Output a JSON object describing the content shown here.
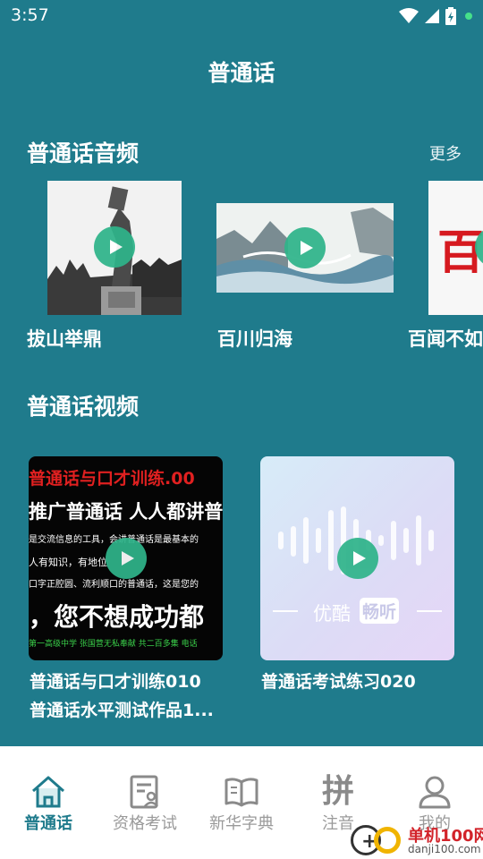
{
  "status_bar": {
    "time": "3:57"
  },
  "header": {
    "title": "普通话"
  },
  "audio_section": {
    "title": "普通话音频",
    "more": "更多",
    "items": [
      {
        "label": "拔山举鼎"
      },
      {
        "label": "百川归海"
      },
      {
        "label": "百闻不如一见",
        "thumb_text": "百"
      }
    ]
  },
  "video_section": {
    "title": "普通话视频",
    "items": [
      {
        "title": "普通话与口才训练010",
        "subtitle": "普通话水平测试作品1...",
        "thumb_lines": [
          "普通话与口才训练.00",
          "推广普通话  人人都讲普",
          "是交流信息的工具，会讲普通话是最基本的",
          "人有知识，有地位",
          "口字正腔圆、流利顺口的普通话，这是您的",
          "，您不想成功都",
          "第一高级中学  张国营无私奉献 共二百多集 电话"
        ]
      },
      {
        "title": "普通话考试练习020",
        "thumb_text": "优酷",
        "thumb_badge": "畅听"
      }
    ]
  },
  "bottom_nav": {
    "items": [
      {
        "label": "普通话",
        "icon": "home-icon",
        "active": true
      },
      {
        "label": "资格考试",
        "icon": "exam-document-icon",
        "active": false
      },
      {
        "label": "新华字典",
        "icon": "open-book-icon",
        "active": false
      },
      {
        "label": "注音",
        "icon": "pinyin-glyph-icon",
        "glyph": "拼",
        "active": false
      },
      {
        "label": "我的",
        "icon": "user-icon",
        "active": false
      }
    ]
  },
  "watermark": {
    "line1": "单机100网",
    "line2": "danji100.com"
  },
  "colors": {
    "background": "#1f7b8c",
    "play_button": "#2fb48a",
    "nav_active": "#1f7b8c",
    "nav_inactive": "#9a9a9a"
  }
}
